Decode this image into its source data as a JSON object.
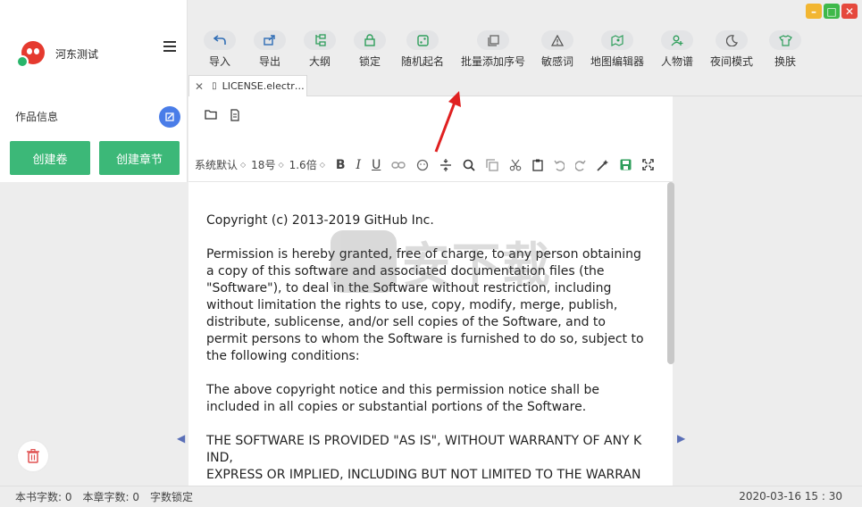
{
  "window": {
    "minimize_label": "–",
    "maximize_label": "□",
    "close_label": "✕"
  },
  "sidebar": {
    "username": "河东测试",
    "works_info_label": "作品信息",
    "create_volume_label": "创建卷",
    "create_chapter_label": "创建章节"
  },
  "toolbar": {
    "items": [
      {
        "label": "导入",
        "icon": "import-icon"
      },
      {
        "label": "导出",
        "icon": "export-icon"
      },
      {
        "label": "大纲",
        "icon": "outline-icon"
      },
      {
        "label": "锁定",
        "icon": "lock-icon"
      },
      {
        "label": "随机起名",
        "icon": "random-name-icon"
      },
      {
        "label": "批量添加序号",
        "icon": "batch-number-icon"
      },
      {
        "label": "敏感词",
        "icon": "warning-icon"
      },
      {
        "label": "地图编辑器",
        "icon": "map-editor-icon"
      },
      {
        "label": "人物谱",
        "icon": "person-add-icon"
      },
      {
        "label": "夜间模式",
        "icon": "moon-icon"
      },
      {
        "label": "换肤",
        "icon": "shirt-icon"
      }
    ]
  },
  "tabs": [
    {
      "label": "LICENSE.electr…"
    }
  ],
  "format": {
    "font_family": "系统默认",
    "font_size": "18号",
    "line_height": "1.6倍"
  },
  "document": {
    "paragraphs": [
      "    Copyright (c) 2013-2019 GitHub Inc.",
      "Permission is hereby granted, free of charge, to any person obtaining\na copy of this software and associated documentation files (the\n\"Software\"), to deal in the Software without restriction, including\nwithout limitation the rights to use, copy, modify, merge, publish,\ndistribute, sublicense, and/or sell copies of the Software, and to\npermit persons to whom the Software is furnished to do so, subject to\nthe following conditions:",
      "The above copyright notice and this permission notice shall be\nincluded in all copies or substantial portions of the Software.",
      "THE SOFTWARE IS PROVIDED \"AS IS\", WITHOUT WARRANTY OF ANY K\nIND,\nEXPRESS OR IMPLIED, INCLUDING BUT NOT LIMITED TO THE WARRAN"
    ]
  },
  "watermark": {
    "text": "安下载"
  },
  "status": {
    "book_words": "本书字数: 0",
    "chapter_words": "本章字数: 0",
    "word_lock": "字数锁定",
    "datetime": "2020-03-16 15 : 30"
  },
  "colors": {
    "accent_green": "#3cb878",
    "accent_blue": "#4a7de8",
    "pointer_red": "#e02020"
  }
}
